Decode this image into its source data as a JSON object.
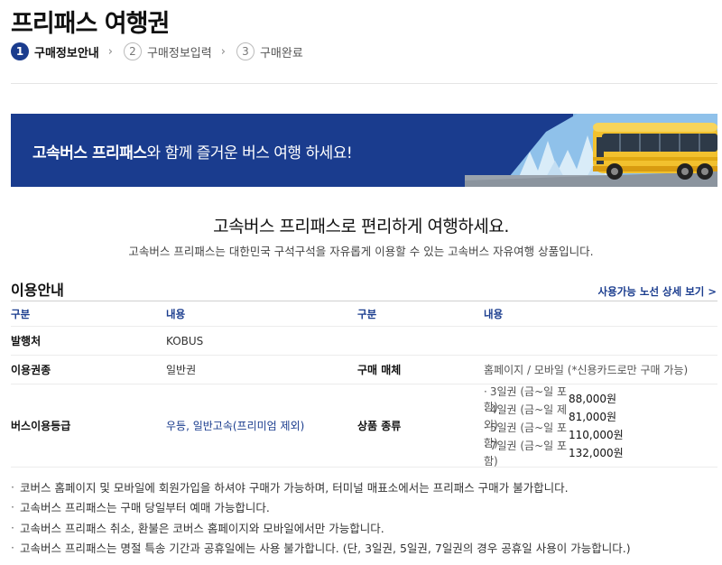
{
  "page": {
    "title": "프리패스 여행권"
  },
  "steps": [
    {
      "num": "1",
      "label": "구매정보안내"
    },
    {
      "num": "2",
      "label": "구매정보입력"
    },
    {
      "num": "3",
      "label": "구매완료"
    }
  ],
  "banner": {
    "bold_text": "고속버스 프리패스",
    "rest_text": "와 함께 즐거운 버스 여행 하세요!"
  },
  "intro": {
    "heading": "고속버스 프리패스로 편리하게 여행하세요.",
    "subheading": "고속버스 프리패스는 대한민국 구석구석을 자유롭게 이용할 수 있는 고속버스 자유여행 상품입니다."
  },
  "usage": {
    "section_title": "이용안내",
    "route_link": "사용가능 노선 상세 보기 >",
    "headers": [
      "구분",
      "내용",
      "구분",
      "내용"
    ],
    "issuer_label": "발행처",
    "issuer_value": "KOBUS",
    "ticket_type_label": "이용권종",
    "ticket_type_value": "일반권",
    "purchase_media_label": "구매 매체",
    "purchase_media_value": "홈페이지 / 모바일 (*신용카드로만 구매 가능)",
    "bus_grade_label": "버스이용등급",
    "bus_grade_value": "우등, 일반고속(프리미엄 제외)",
    "product_type_label": "상품 종류",
    "products": [
      {
        "name": "3일권 (금~일 포함)",
        "price": "88,000원"
      },
      {
        "name": "4일권 (금~일 제외)",
        "price": "81,000원"
      },
      {
        "name": "5일권 (금~일 포함)",
        "price": "110,000원"
      },
      {
        "name": "7일권 (금~일 포함)",
        "price": "132,000원"
      }
    ]
  },
  "notes": [
    "코버스 홈페이지 및 모바일에 회원가입을 하셔야 구매가 가능하며, 터미널 매표소에서는 프리패스 구매가 불가합니다.",
    "고속버스 프리패스는 구매 당일부터 예매 가능합니다.",
    "고속버스 프리패스 취소, 환불은 코버스 홈페이지와 모바일에서만 가능합니다.",
    "고속버스 프리패스는 명절 특송 기간과 공휴일에는 사용 불가합니다. (단, 3일권, 5일권, 7일권의 경우 공휴일 사용이 가능합니다.)"
  ],
  "colors": {
    "brand_navy": "#1a3c8e",
    "bus_yellow": "#f2c12e"
  }
}
